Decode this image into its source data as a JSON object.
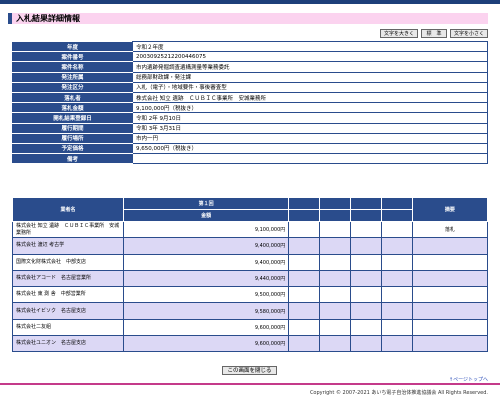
{
  "page": {
    "title": "入札結果詳細情報",
    "font_buttons": [
      "文字を大きく",
      "標　準",
      "文字を小さく"
    ]
  },
  "details": [
    {
      "label": "年度",
      "value": "令和２年度"
    },
    {
      "label": "案件番号",
      "value": "20030925212200446075"
    },
    {
      "label": "案件名称",
      "value": "市内遺跡発掘調査遺構測量等業務委託"
    },
    {
      "label": "発注所属",
      "value": "総務部財政課・発注課"
    },
    {
      "label": "発注区分",
      "value": "入札（電子）・地域要件・事後審査型"
    },
    {
      "label": "落札者",
      "value": "株式会社 知立 遺跡　ＣＵＢＩＣ事業所　安城業務所"
    },
    {
      "label": "落札金額",
      "value": "9,100,000円（税抜き）"
    },
    {
      "label": "開札結果登録日",
      "value": "令和 2年  9月10日"
    },
    {
      "label": "履行期間",
      "value": "令和 3年 3月31日"
    },
    {
      "label": "履行場所",
      "value": "市内一円"
    },
    {
      "label": "予定価格",
      "value": "9,650,000円（税抜き）"
    },
    {
      "label": "備考",
      "value": ""
    }
  ],
  "bids": {
    "header_company": "業者名",
    "header_round": "第１回",
    "header_amount": "金額",
    "header_remark": "摘要",
    "rows": [
      {
        "company": "株式会社 知立 遺跡　ＣＵＢＩＣ事業所　安城業務所",
        "amount": "9,100,000円",
        "remark": "落札"
      },
      {
        "company": "株式会社 渡辺 考古学",
        "amount": "9,400,000円",
        "remark": ""
      },
      {
        "company": "国際文化財株式会社　中部支店",
        "amount": "9,400,000円",
        "remark": ""
      },
      {
        "company": "株式会社アコード　名古屋営業所",
        "amount": "9,440,000円",
        "remark": ""
      },
      {
        "company": "株式会社 東 測 舎　中部営業所",
        "amount": "9,500,000円",
        "remark": ""
      },
      {
        "company": "株式会社イビソク　名古屋支店",
        "amount": "9,580,000円",
        "remark": ""
      },
      {
        "company": "株式会社二友組",
        "amount": "9,600,000円",
        "remark": ""
      },
      {
        "company": "株式会社ユニオン　名古屋支店",
        "amount": "9,600,000円",
        "remark": ""
      }
    ]
  },
  "footer": {
    "close_label": "この画面を閉じる",
    "page_top_label": "↑ページトップへ",
    "copyright": "Copyright © 2007-2021 あいち電子自治体推進協議会 All Rights Reserved."
  },
  "colors": {
    "header_blue": "#2a4c8c",
    "title_pink": "#fbd3ef",
    "row_alt": "#dcd8f5",
    "accent_line": "#c43a8a"
  }
}
